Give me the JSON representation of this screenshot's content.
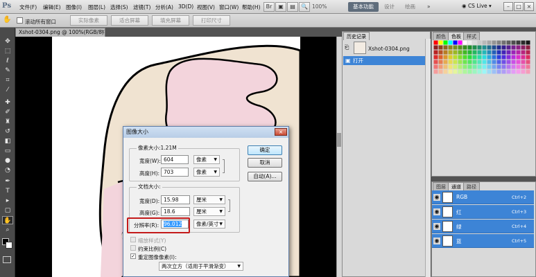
{
  "app": {
    "logo": "Ps"
  },
  "menu": [
    "文件(F)",
    "编辑(E)",
    "图像(I)",
    "图层(L)",
    "选择(S)",
    "滤镜(T)",
    "分析(A)",
    "3D(D)",
    "视图(V)",
    "窗口(W)",
    "帮助(H)"
  ],
  "toolbar": {
    "zoom": "100%"
  },
  "workspaces": {
    "active": "基本功能",
    "design": "设计",
    "painting": "绘画",
    "more": "»"
  },
  "cslive": "CS Live",
  "options": {
    "scroll_all": "滚动所有窗口",
    "actual_pixels": "实际像素",
    "fit_screen": "适合屏幕",
    "fill_screen": "填充屏幕",
    "print_size": "打印尺寸"
  },
  "document": {
    "tab_title": "Xshot-0304.png @ 100%(RGB/8)",
    "close": "×"
  },
  "history": {
    "tab": "历史记录",
    "snapshot_name": "Xshot-0304.png",
    "steps": [
      "打开"
    ]
  },
  "swatch_tabs": [
    "颜色",
    "色板",
    "样式"
  ],
  "channel_tabs": [
    "图层",
    "通道",
    "路径"
  ],
  "channels": [
    {
      "name": "RGB",
      "shortcut": "Ctrl+2"
    },
    {
      "name": "红",
      "shortcut": "Ctrl+3"
    },
    {
      "name": "绿",
      "shortcut": "Ctrl+4"
    },
    {
      "name": "蓝",
      "shortcut": "Ctrl+5"
    }
  ],
  "dialog": {
    "title": "图像大小",
    "pixel_dims": "像素大小:1.21M",
    "width_label": "宽度(W):",
    "width_value": "604",
    "width_unit": "像素",
    "height_label": "高度(H):",
    "height_value": "703",
    "height_unit": "像素",
    "doc_size": "文档大小:",
    "doc_width_label": "宽度(D):",
    "doc_width_value": "15.98",
    "doc_width_unit": "厘米",
    "doc_height_label": "高度(G):",
    "doc_height_value": "18.6",
    "doc_height_unit": "厘米",
    "resolution_label": "分辨率(R):",
    "resolution_value": "96.012",
    "resolution_unit": "像素/英寸",
    "scale_styles": "缩放样式(Y)",
    "constrain": "约束比例(C)",
    "resample": "重定图像像素(I):",
    "resample_method": "两次立方（适用于平滑渐变）",
    "ok": "确定",
    "cancel": "取消",
    "auto": "自动(A)..."
  },
  "colors": {
    "selection": "#3d84d6",
    "highlight": "#c41a1a",
    "skin": "#f0e3d1",
    "pink": "#f3d4dc"
  }
}
